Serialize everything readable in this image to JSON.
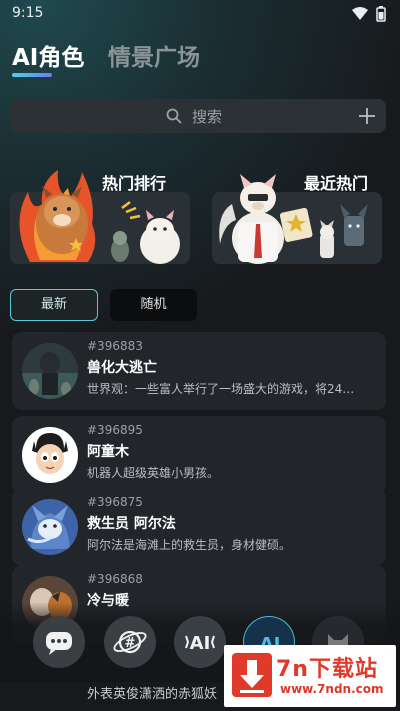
{
  "status_bar": {
    "time": "9:15"
  },
  "header": {
    "tabs": [
      {
        "label": "AI角色",
        "active": true
      },
      {
        "label": "情景广场",
        "active": false
      }
    ]
  },
  "search": {
    "placeholder": "搜索"
  },
  "banners": [
    {
      "title": "热门排行"
    },
    {
      "title": "最近热门"
    }
  ],
  "filters": [
    {
      "label": "最新",
      "selected": true
    },
    {
      "label": "随机",
      "selected": false
    }
  ],
  "characters": [
    {
      "id": "#396883",
      "name": "兽化大逃亡",
      "desc": "世界观：一些富人举行了一场盛大的游戏，将24…"
    },
    {
      "id": "#396895",
      "name": "阿童木",
      "desc": "机器人超级英雄小男孩。"
    },
    {
      "id": "#396875",
      "name": "救生员 阿尔法",
      "desc": "阿尔法是海滩上的救生员，身材健硕。"
    },
    {
      "id": "#396868",
      "name": "冷与暖",
      "desc": ""
    }
  ],
  "partial_desc": "外表英俊潇洒的赤狐妖",
  "bottom_nav": [
    {
      "icon": "chat-icon"
    },
    {
      "icon": "planet-hash-icon"
    },
    {
      "icon": "ai-sparkle-icon"
    },
    {
      "icon": "ai-icon",
      "active": true
    },
    {
      "icon": "cat-icon"
    }
  ],
  "watermark": {
    "title": "7n下载站",
    "url": "www.7ndn.com"
  },
  "colors": {
    "accent": "#5fc6d9",
    "background": "#17191c",
    "card": "#22262a"
  }
}
